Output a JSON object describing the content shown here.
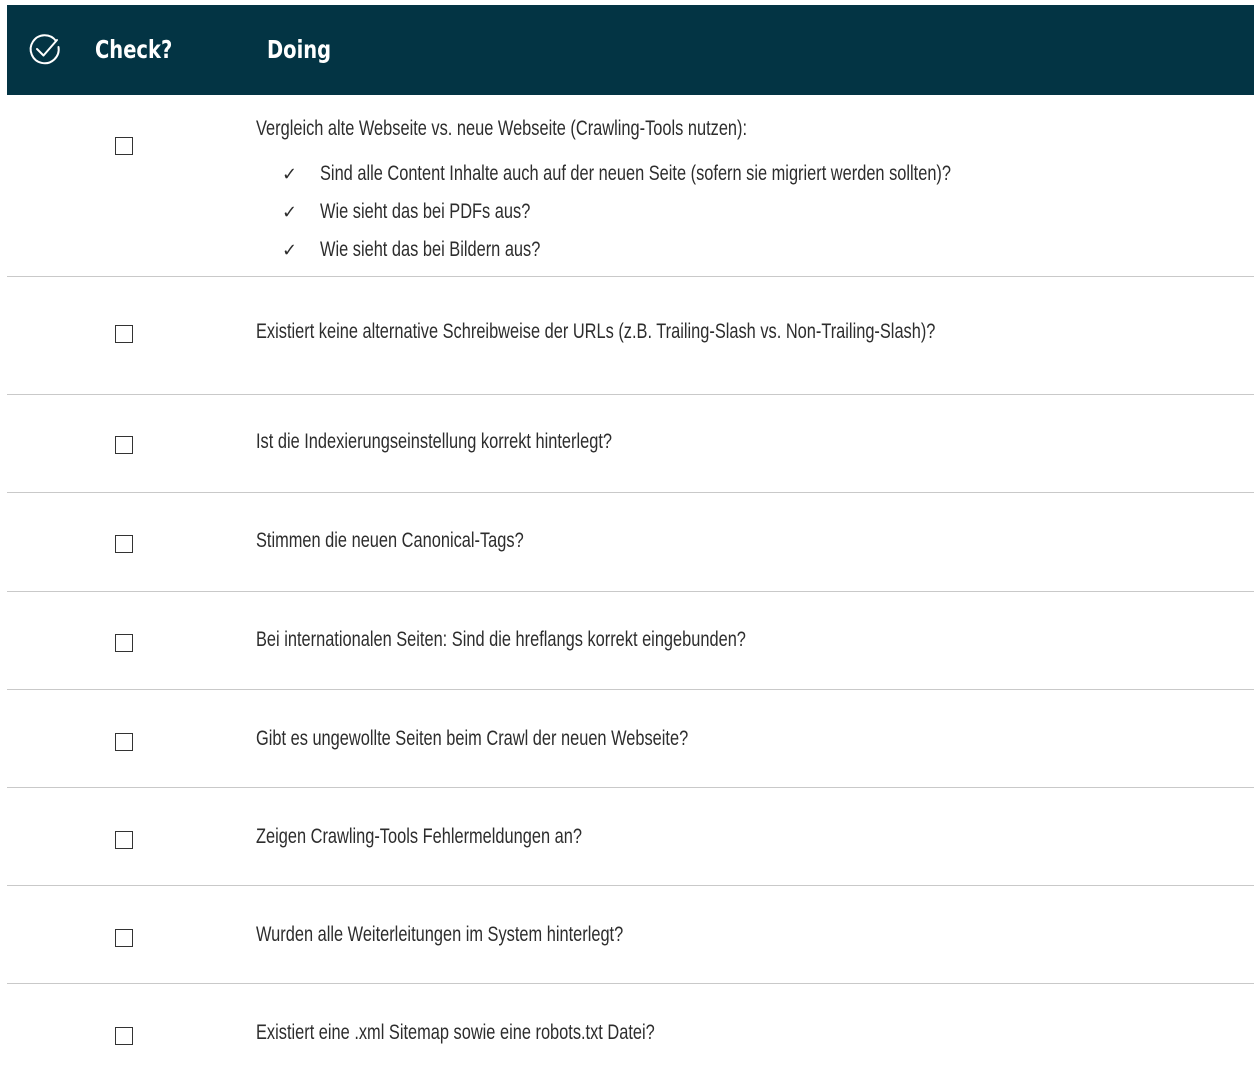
{
  "header": {
    "icon": "check-circle-icon",
    "check_label": "Check?",
    "doing_label": "Doing",
    "background": "#033444"
  },
  "rows": [
    {
      "checked": false,
      "text": "Vergleich alte Webseite vs. neue Webseite (Crawling-Tools nutzen):",
      "subitems": [
        "Sind alle Content Inhalte auch auf der neuen Seite (sofern sie migriert werden sollten)?",
        "Wie sieht das bei PDFs aus?",
        "Wie sieht das bei Bildern aus?"
      ]
    },
    {
      "checked": false,
      "text": "Existiert keine alternative Schreibweise der URLs (z.B. Trailing-Slash vs. Non-Trailing-Slash)?"
    },
    {
      "checked": false,
      "text": "Ist die Indexierungseinstellung korrekt hinterlegt?"
    },
    {
      "checked": false,
      "text": "Stimmen die neuen Canonical-Tags?"
    },
    {
      "checked": false,
      "text": "Bei internationalen Seiten: Sind die hreflangs korrekt eingebunden?"
    },
    {
      "checked": false,
      "text": "Gibt es ungewollte Seiten beim Crawl der neuen Webseite?"
    },
    {
      "checked": false,
      "text": "Zeigen Crawling-Tools Fehlermeldungen an?"
    },
    {
      "checked": false,
      "text": "Wurden alle Weiterleitungen im System hinterlegt?"
    },
    {
      "checked": false,
      "text": "Existiert eine .xml Sitemap sowie eine robots.txt Datei?"
    }
  ]
}
